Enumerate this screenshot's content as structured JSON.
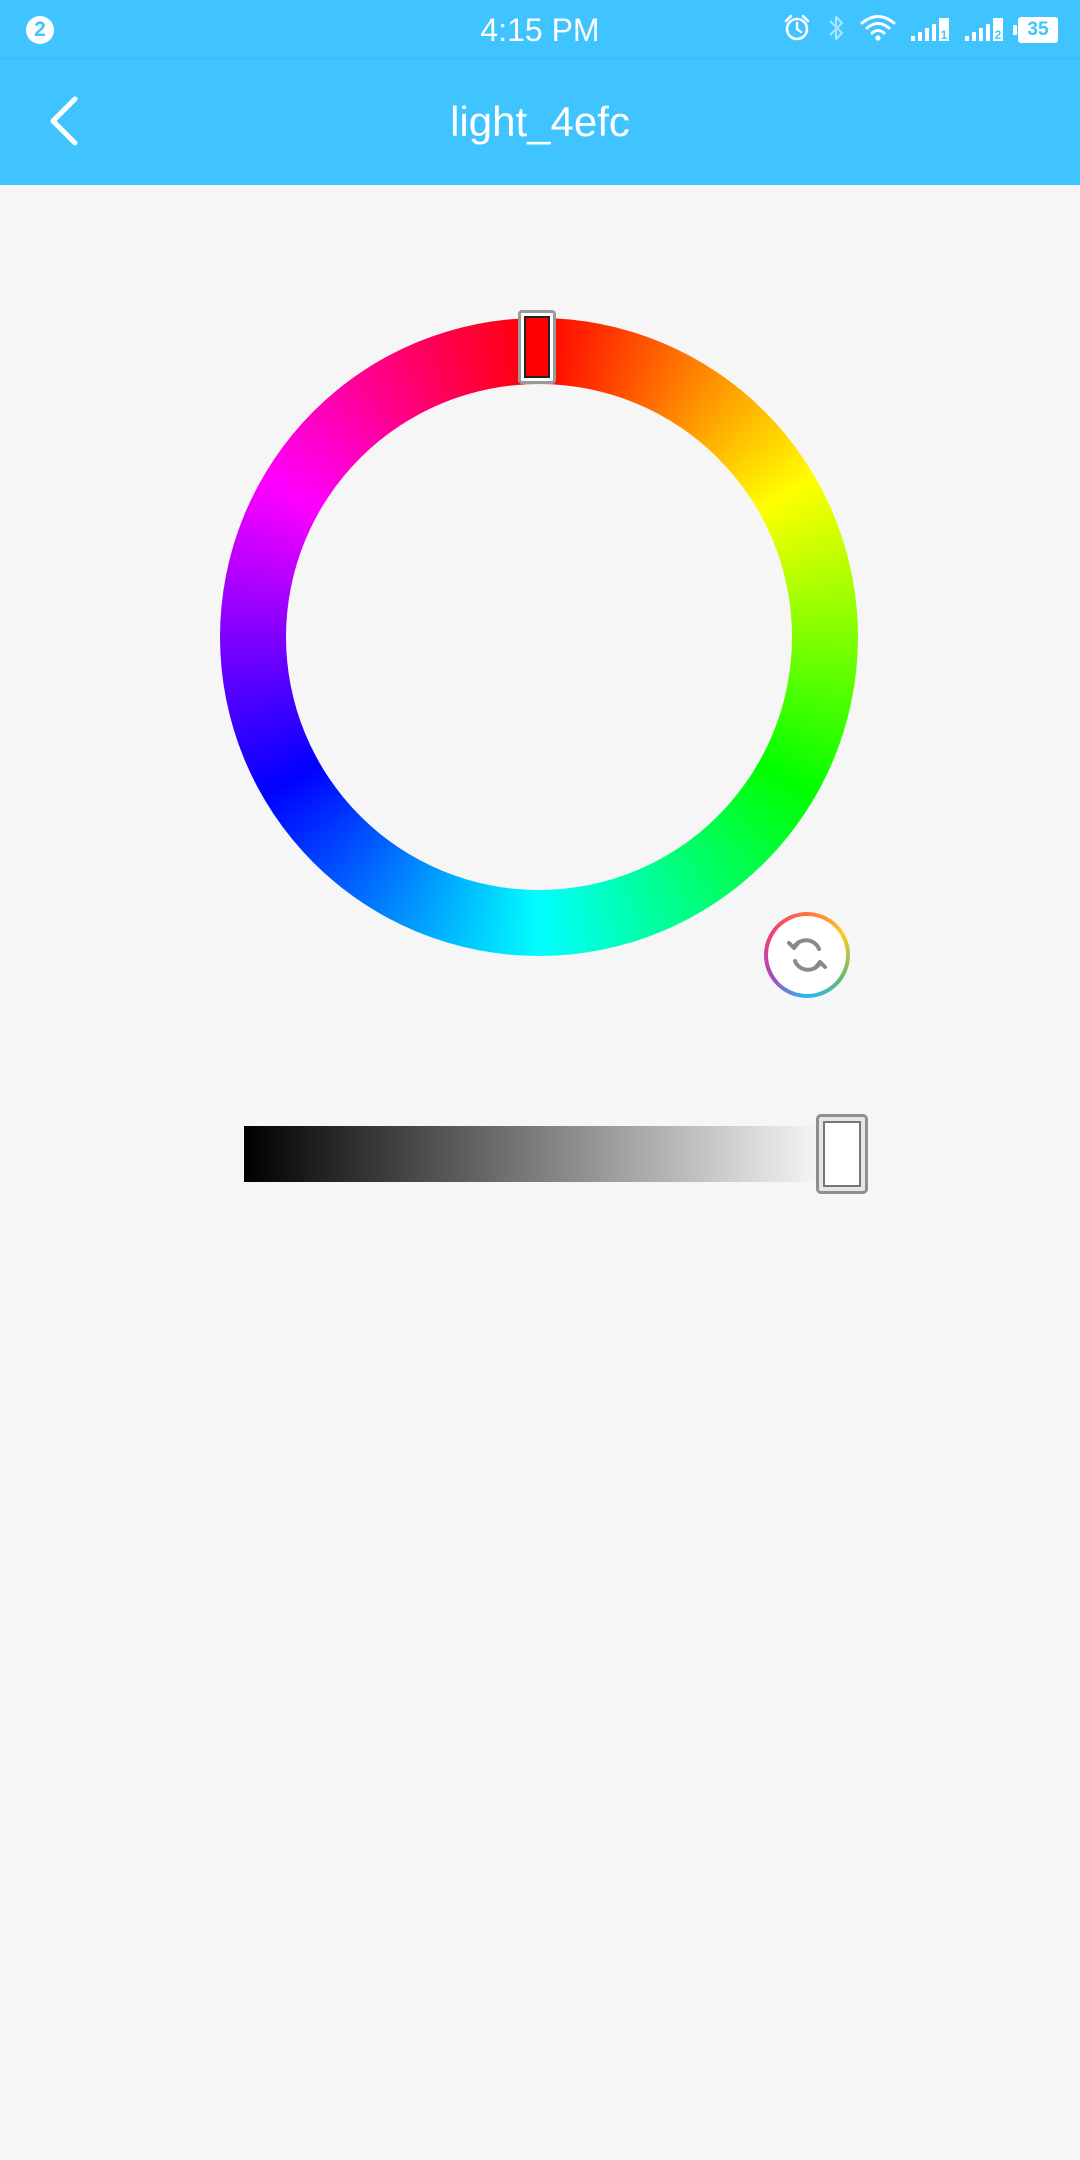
{
  "status_bar": {
    "notification_count": "2",
    "time": "4:15 PM",
    "battery": "35",
    "sim1_label": "1",
    "sim2_label": "2",
    "icons": [
      "alarm-icon",
      "bluetooth-icon",
      "wifi-icon",
      "signal-sim1-icon",
      "signal-sim2-icon",
      "battery-icon"
    ]
  },
  "app_bar": {
    "title": "light_4efc",
    "back_icon": "chevron-left-icon"
  },
  "colors": {
    "primary": "#40c4ff",
    "background": "#f6f6f6",
    "selected_hue": "#ff0000"
  },
  "color_wheel": {
    "selected_hue_degrees": 0
  },
  "reset_button": {
    "icon": "refresh-icon"
  },
  "brightness_slider": {
    "value_fraction": 1.0
  }
}
